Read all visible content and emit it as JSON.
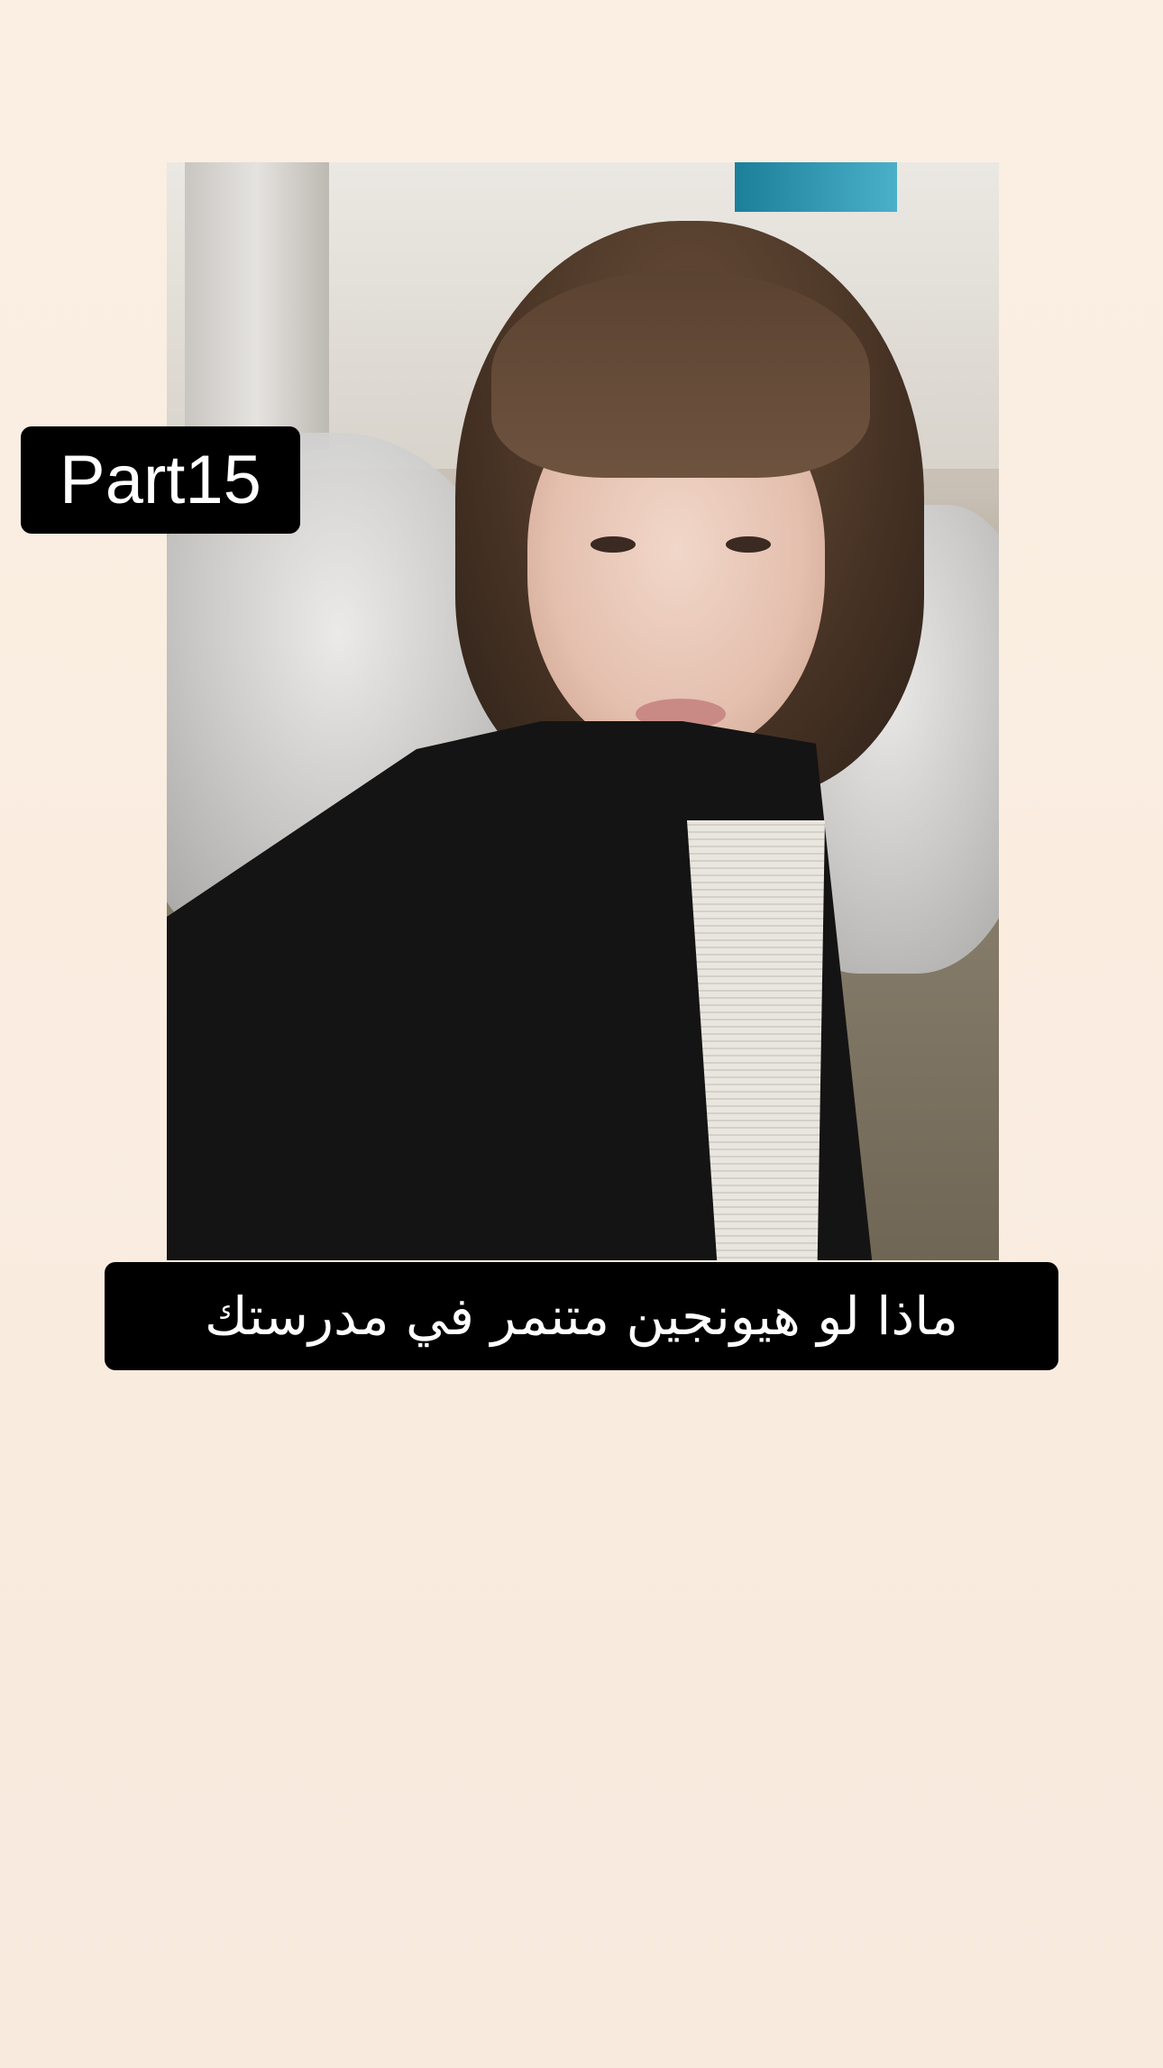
{
  "story": {
    "background_color": "#fbefe3",
    "photo": {
      "description_icon": "portrait-photo"
    },
    "part_label": "Part15",
    "caption": "ماذا لو هيونجين متنمر في مدرستك"
  }
}
